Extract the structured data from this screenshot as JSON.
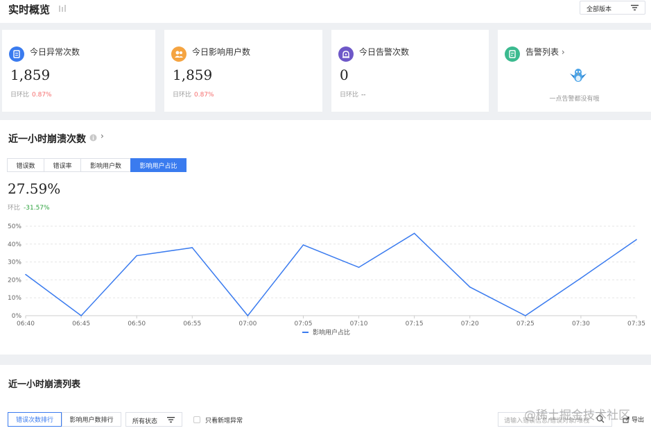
{
  "header": {
    "title": "实时概览",
    "version_select": "全部版本"
  },
  "cards": [
    {
      "title": "今日异常次数",
      "value": "1,859",
      "sub_label": "日环比",
      "sub_value": "0.87%",
      "icon": "error-list-icon",
      "color": "#3a7bef"
    },
    {
      "title": "今日影响用户数",
      "value": "1,859",
      "sub_label": "日环比",
      "sub_value": "0.87%",
      "icon": "users-icon",
      "color": "#f5a441"
    },
    {
      "title": "今日告警次数",
      "value": "0",
      "sub_label": "日环比",
      "sub_value": "--",
      "icon": "alarm-icon",
      "color": "#6e58c8"
    },
    {
      "title": "告警列表",
      "empty_text": "一点告警都没有哦",
      "icon": "alert-list-icon",
      "color": "#3bba8f"
    }
  ],
  "crash_section": {
    "title": "近一小时崩溃次数",
    "tabs": [
      "错误数",
      "错误率",
      "影响用户数",
      "影响用户占比"
    ],
    "active_tab": 3,
    "big_value": "27.59%",
    "ring_label": "环比",
    "ring_value": "-31.57%"
  },
  "chart_data": {
    "type": "line",
    "x": [
      "06:40",
      "06:45",
      "06:50",
      "06:55",
      "07:00",
      "07:05",
      "07:10",
      "07:15",
      "07:20",
      "07:25",
      "07:30",
      "07:35"
    ],
    "series": [
      {
        "name": "影响用户占比",
        "values": [
          23,
          0,
          33.5,
          38,
          0,
          39.5,
          27,
          46,
          16,
          0,
          21,
          42.5
        ]
      }
    ],
    "y_ticks": [
      "0%",
      "10%",
      "20%",
      "30%",
      "40%",
      "50%"
    ],
    "ylim": [
      0,
      50
    ],
    "color": "#3a7bef",
    "grid": true,
    "legend": "bottom"
  },
  "list_section": {
    "title": "近一小时崩溃列表",
    "rank_buttons": [
      "错误次数排行",
      "影响用户数排行"
    ],
    "status_select": "所有状态",
    "checkbox_label": "只看新增异常",
    "search_placeholder": "请输入错误信息/错误对象/堆栈",
    "export_label": "导出"
  },
  "watermark": "@稀土掘金技术社区"
}
